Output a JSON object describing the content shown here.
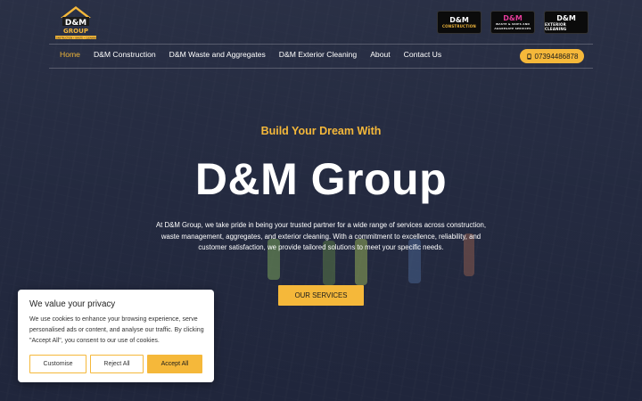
{
  "site": {
    "logo_text": "GROUP",
    "logo_tagline": "CONSTRUCTION • WASTE • CLEANING",
    "brands": [
      {
        "icon": "dm-construction-logo-icon",
        "line1": "D&M",
        "line2": "CONSTRUCTION"
      },
      {
        "icon": "dm-waste-aggregates-logo-icon",
        "line1": "D&M",
        "line2": "WASTE & SKIPS AND AGGREGATE SERVICES"
      },
      {
        "icon": "dm-exterior-cleaning-logo-icon",
        "line1": "D&M",
        "line2": "EXTERIOR CLEANING"
      }
    ]
  },
  "nav": {
    "items": [
      "Home",
      "D&M Construction",
      "D&M Waste and Aggregates",
      "D&M Exterior Cleaning",
      "About",
      "Contact Us"
    ],
    "active": "Home",
    "phone": "07394486878"
  },
  "hero": {
    "tagline": "Build Your Dream With",
    "headline": "D&M Group",
    "intro": "At D&M Group, we take pride in being your trusted partner for a wide range of services across construction, waste management, aggregates, and exterior cleaning. With a commitment to excellence, reliability, and customer satisfaction, we provide tailored solutions to meet your specific needs.",
    "cta": "OUR SERVICES"
  },
  "cookie": {
    "title": "We value your privacy",
    "text": "We use cookies to enhance your browsing experience, serve personalised ads or content, and analyse our traffic. By clicking \"Accept All\", you consent to our use of cookies.",
    "customise": "Customise",
    "reject": "Reject All",
    "accept": "Accept All"
  },
  "colors": {
    "accent": "#f5b83a",
    "overlay": "#161c32",
    "text": "#ffffff"
  }
}
